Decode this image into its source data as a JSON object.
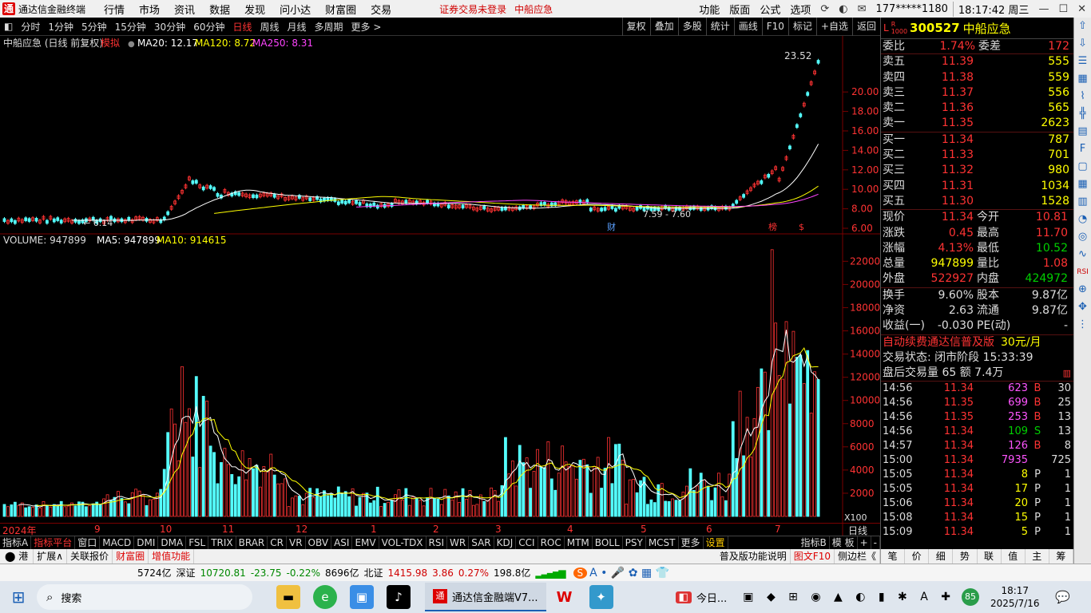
{
  "app": {
    "title": "通达信金融终端",
    "menu": [
      "行情",
      "市场",
      "资讯",
      "数据",
      "发现",
      "问小达",
      "财富圈",
      "交易"
    ],
    "warning": "证券交易未登录",
    "stock_link": "中船应急",
    "right_menu": [
      "功能",
      "版面",
      "公式",
      "选项"
    ],
    "user": "177*****1180",
    "clock": "18:17:42 周三"
  },
  "toolbar": {
    "periods": [
      "分时",
      "1分钟",
      "5分钟",
      "15分钟",
      "30分钟",
      "60分钟",
      "日线",
      "周线",
      "月线",
      "多周期",
      "更多 >"
    ],
    "selected": "日线",
    "right": [
      "复权",
      "叠加",
      "多股",
      "统计",
      "画线",
      "F10",
      "标记",
      "+自选",
      "返回"
    ]
  },
  "main_chart": {
    "header_name": "中船应急 (日线 前复权)",
    "header_mode": "模拟",
    "ma20": "MA20: 12.17",
    "ma120": "MA120: 8.72",
    "ma250": "MA250: 8.31",
    "peak_label": "23.52",
    "low_label": "← 6.14",
    "range_label": "7.59 - 7.60",
    "event_cai": "财",
    "event_bang": "榜",
    "y_ticks": [
      "20.00",
      "18.00",
      "16.00",
      "14.00",
      "12.00",
      "10.00",
      "8.00",
      "6.00"
    ]
  },
  "volume_chart": {
    "header": "VOLUME: 947899",
    "ma5": "MA5: 947899",
    "ma10": "MA10: 914615",
    "y_ticks": [
      "22000",
      "20000",
      "18000",
      "16000",
      "14000",
      "12000",
      "10000",
      "8000",
      "6000",
      "4000",
      "2000"
    ],
    "unit": "X100",
    "months": [
      "2024年",
      "9",
      "10",
      "11",
      "12",
      "1",
      "2",
      "3",
      "4",
      "5",
      "6",
      "7"
    ],
    "period": "日线"
  },
  "indicator_tabs": [
    "指标A",
    "指标平台",
    "窗口",
    "MACD",
    "DMI",
    "DMA",
    "FSL",
    "TRIX",
    "BRAR",
    "CR",
    "VR",
    "OBV",
    "ASI",
    "EMV",
    "VOL-TDX",
    "RSI",
    "WR",
    "SAR",
    "KDJ",
    "CCI",
    "ROC",
    "MTM",
    "BOLL",
    "PSY",
    "MCST",
    "更多",
    "设置"
  ],
  "indicator_right": [
    "指标B",
    "模 板",
    "+",
    "-"
  ],
  "bottom_tabs": [
    "扩展∧",
    "关联报价",
    "财富圈",
    "增值功能"
  ],
  "bottom_right": [
    "普及版功能说明",
    "图文F10",
    "侧边栏《"
  ],
  "quote": {
    "code": "300527",
    "name": "中船应急",
    "weibi_label": "委比",
    "weibi": "1.74%",
    "weicha_label": "委差",
    "weicha": "172",
    "asks": [
      [
        "卖五",
        "11.39",
        "555"
      ],
      [
        "卖四",
        "11.38",
        "559"
      ],
      [
        "卖三",
        "11.37",
        "556"
      ],
      [
        "卖二",
        "11.36",
        "565"
      ],
      [
        "卖一",
        "11.35",
        "2623"
      ]
    ],
    "bids": [
      [
        "买一",
        "11.34",
        "787"
      ],
      [
        "买二",
        "11.33",
        "701"
      ],
      [
        "买三",
        "11.32",
        "980"
      ],
      [
        "买四",
        "11.31",
        "1034"
      ],
      [
        "买五",
        "11.30",
        "1528"
      ]
    ],
    "stats": [
      [
        "现价",
        "11.34",
        "今开",
        "10.81"
      ],
      [
        "涨跌",
        "0.45",
        "最高",
        "11.70"
      ],
      [
        "涨幅",
        "4.13%",
        "最低",
        "10.52"
      ],
      [
        "总量",
        "947899",
        "量比",
        "1.08"
      ],
      [
        "外盘",
        "522927",
        "内盘",
        "424972"
      ]
    ],
    "stats2": [
      [
        "换手",
        "9.60%",
        "股本",
        "9.87亿"
      ],
      [
        "净资",
        "2.63",
        "流通",
        "9.87亿"
      ],
      [
        "收益(一)",
        "-0.030",
        "PE(动)",
        "-"
      ]
    ],
    "promo": "自动续费通达信普及版",
    "promo_price": "30元/月",
    "trade_state": "交易状态: 闭市阶段 15:33:39",
    "after_hours": "盘后交易量 65 额 7.4万",
    "ticks": [
      [
        "14:56",
        "11.34",
        "623",
        "B",
        "30"
      ],
      [
        "14:56",
        "11.35",
        "699",
        "B",
        "25"
      ],
      [
        "14:56",
        "11.35",
        "253",
        "B",
        "13"
      ],
      [
        "14:56",
        "11.34",
        "109",
        "S",
        "13"
      ],
      [
        "14:57",
        "11.34",
        "126",
        "B",
        "8"
      ],
      [
        "15:00",
        "11.34",
        "7935",
        "",
        "725"
      ],
      [
        "15:05",
        "11.34",
        "8",
        "P",
        "1"
      ],
      [
        "15:05",
        "11.34",
        "17",
        "P",
        "1"
      ],
      [
        "15:06",
        "11.34",
        "20",
        "P",
        "1"
      ],
      [
        "15:08",
        "11.34",
        "15",
        "P",
        "1"
      ],
      [
        "15:09",
        "11.34",
        "5",
        "P",
        "1"
      ]
    ],
    "tabs": [
      "笔",
      "价",
      "细",
      "势",
      "联",
      "值",
      "主",
      "筹"
    ]
  },
  "status": {
    "a": "5724亿",
    "sz_label": "深证",
    "sz_val": "10720.81",
    "sz_chg": "-23.75",
    "sz_pct": "-0.22%",
    "sz_amt": "8696亿",
    "bz_label": "北证",
    "bz_val": "1415.98",
    "bz_chg": "3.86",
    "bz_pct": "0.27%",
    "bz_amt": "198.8亿"
  },
  "taskbar": {
    "search": "搜索",
    "active": "通达信金融端V7...",
    "news": "今日...",
    "time": "18:17",
    "date": "2025/7/16",
    "badge": "85"
  },
  "colors": {
    "up": "#ff3333",
    "down": "#54ffff",
    "ma5": "#ffffff",
    "ma10": "#ffff00",
    "bg": "#000000"
  }
}
